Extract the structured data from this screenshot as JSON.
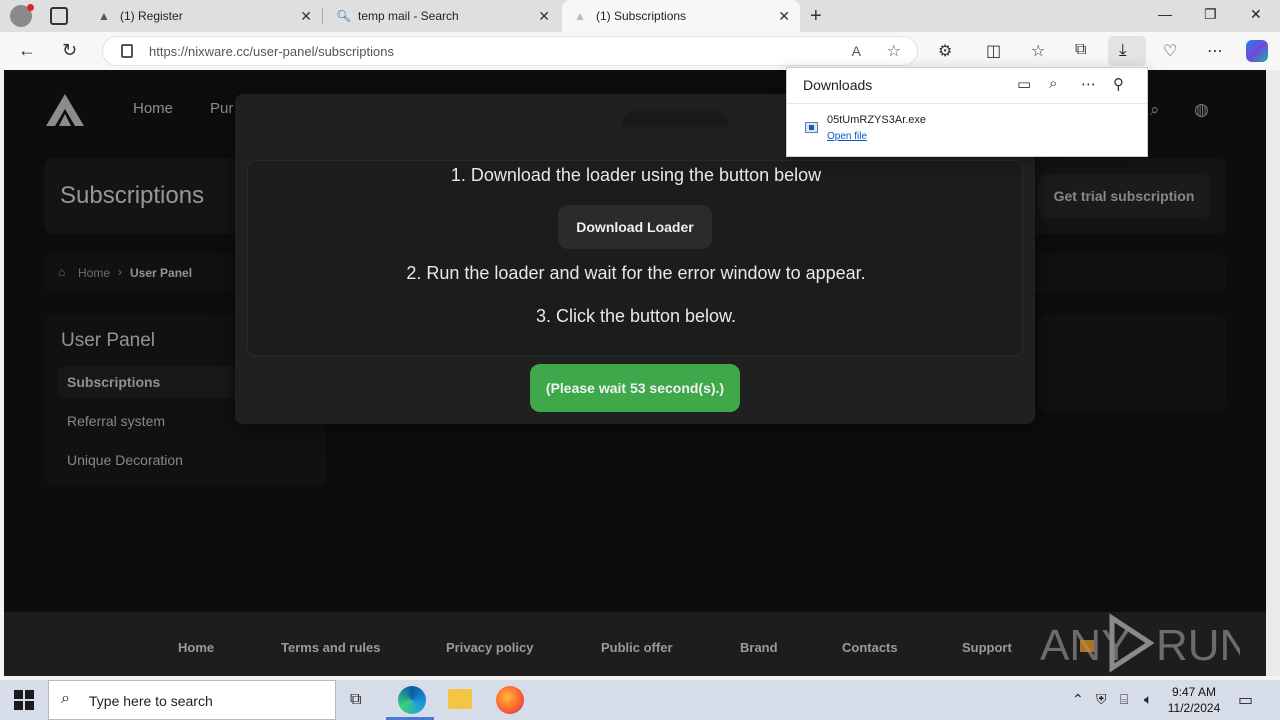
{
  "browser": {
    "tabs": [
      {
        "label": "(1) Register",
        "icon": "nixware-logo-icon"
      },
      {
        "label": "temp mail - Search",
        "icon": "search-icon"
      },
      {
        "label": "(1) Subscriptions",
        "icon": "nixware-logo-icon"
      }
    ],
    "url": "https://nixware.cc/user-panel/subscriptions"
  },
  "site": {
    "nav": [
      "Home",
      "Pur"
    ],
    "page_title": "Subscriptions",
    "trial_button": "Get trial subscription",
    "breadcrumb": {
      "home": "Home",
      "current": "User Panel"
    },
    "sidebar": {
      "title": "User Panel",
      "items": [
        "Subscriptions",
        "Referral system",
        "Unique Decoration"
      ]
    },
    "footer": [
      "Home",
      "Terms and rules",
      "Privacy policy",
      "Public offer",
      "Brand",
      "Contacts",
      "Support"
    ]
  },
  "modal": {
    "step1": "1. Download the loader using the button below",
    "download_button": "Download Loader",
    "step2": "2. Run the loader and wait for the error window to appear.",
    "step3": "3. Click the button below.",
    "wait_button": "(Please wait 53 second(s).)",
    "wait_color": "#3ea84a"
  },
  "downloads": {
    "title": "Downloads",
    "file_name": "05tUmRZYS3Ar.exe",
    "open_link": "Open file"
  },
  "watermark": {
    "text_left": "ANY",
    "text_right": "RUN"
  },
  "taskbar": {
    "search_placeholder": "Type here to search",
    "time": "9:47 AM",
    "date": "11/2/2024"
  }
}
